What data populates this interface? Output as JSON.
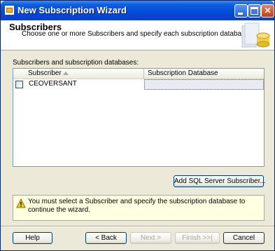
{
  "window": {
    "title": "New Subscription Wizard",
    "controls": [
      "minimize-icon",
      "maximize-icon",
      "close-icon"
    ],
    "close_glyph": "✕"
  },
  "header": {
    "title": "Subscribers",
    "subtitle": "Choose one or more Subscribers and specify each subscription database."
  },
  "subscribers": {
    "section_label": "Subscribers and subscription databases:",
    "columns": [
      "Subscriber",
      "Subscription Database"
    ],
    "rows": [
      {
        "checked": false,
        "subscriber": "CEOVERSANT",
        "database": ""
      }
    ],
    "sorted_column": "Subscriber",
    "sort_direction": "ascending"
  },
  "add_button_label": "Add SQL Server Subscriber...",
  "message": {
    "icon": "warning-icon",
    "text": "You must select a Subscriber and specify the subscription database to continue the wizard."
  },
  "footer": {
    "help": "Help",
    "back": "< Back",
    "next": "Next >",
    "finish": "Finish >>|",
    "cancel": "Cancel"
  },
  "colors": {
    "titlebar": "#0548d8",
    "dialog_background": "#ece9d8",
    "message_background": "#ffffe1",
    "selected_cell": "#e8ebf4"
  }
}
